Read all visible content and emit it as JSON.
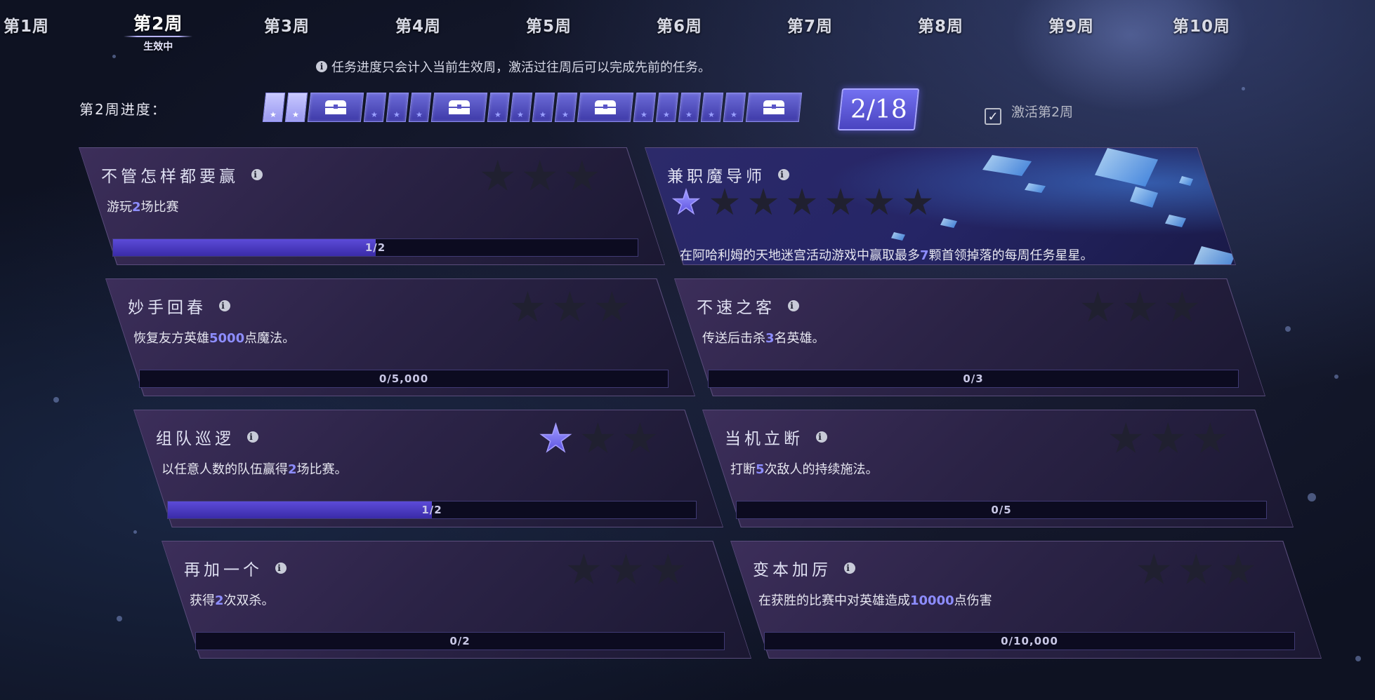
{
  "weeks": [
    {
      "label": "第1周"
    },
    {
      "label": "第2周",
      "sub": "生效中"
    },
    {
      "label": "第3周"
    },
    {
      "label": "第4周"
    },
    {
      "label": "第5周"
    },
    {
      "label": "第6周"
    },
    {
      "label": "第7周"
    },
    {
      "label": "第8周"
    },
    {
      "label": "第9周"
    },
    {
      "label": "第10周"
    }
  ],
  "notice": "任务进度只会计入当前生效周，激活过往周后可以完成先前的任务。",
  "progress": {
    "label": "第2周进度：",
    "stars_done": 2,
    "stars_total": 18,
    "count_text": "2/18",
    "segments": [
      "star-done",
      "star-done",
      "chest",
      "star",
      "star",
      "star",
      "chest",
      "star",
      "star",
      "star",
      "star",
      "chest",
      "star",
      "star",
      "star",
      "star",
      "star",
      "chest"
    ]
  },
  "activate": {
    "label": "激活第2周",
    "checked": true
  },
  "quests": [
    {
      "title": "不管怎样都要赢",
      "desc_parts": [
        "游玩",
        "2",
        "场比赛"
      ],
      "stars_earned": 0,
      "stars_total": 3,
      "progress_text": "1/2",
      "progress": 0.5
    },
    {
      "title": "兼职魔导师",
      "desc_parts": [
        "在阿哈利姆的天地迷宫活动游戏中赢取最多",
        "7",
        "颗首领掉落的每周任务星星。"
      ],
      "stars_earned": 1,
      "stars_total": 7,
      "hero": true
    },
    {
      "title": "妙手回春",
      "desc_parts": [
        "恢复友方英雄",
        "5000",
        "点魔法。"
      ],
      "stars_earned": 0,
      "stars_total": 3,
      "progress_text": "0/5,000",
      "progress": 0
    },
    {
      "title": "不速之客",
      "desc_parts": [
        "传送后击杀",
        "3",
        "名英雄。"
      ],
      "stars_earned": 0,
      "stars_total": 3,
      "progress_text": "0/3",
      "progress": 0
    },
    {
      "title": "组队巡逻",
      "desc_parts": [
        "以任意人数的队伍赢得",
        "2",
        "场比赛。"
      ],
      "stars_earned": 1,
      "stars_total": 3,
      "progress_text": "1/2",
      "progress": 0.5
    },
    {
      "title": "当机立断",
      "desc_parts": [
        "打断",
        "5",
        "次敌人的持续施法。"
      ],
      "stars_earned": 0,
      "stars_total": 3,
      "progress_text": "0/5",
      "progress": 0
    },
    {
      "title": "再加一个",
      "desc_parts": [
        "获得",
        "2",
        "次双杀。"
      ],
      "stars_earned": 0,
      "stars_total": 3,
      "progress_text": "0/2",
      "progress": 0
    },
    {
      "title": "变本加厉",
      "desc_parts": [
        "在获胜的比赛中对英雄造成",
        "10000",
        "点伤害"
      ],
      "stars_earned": 0,
      "stars_total": 3,
      "progress_text": "0/10,000",
      "progress": 0
    }
  ],
  "colors": {
    "accent": "#8d8dff",
    "star_earned": "#9c98ff",
    "bar_fill": "#4a3bc0"
  }
}
